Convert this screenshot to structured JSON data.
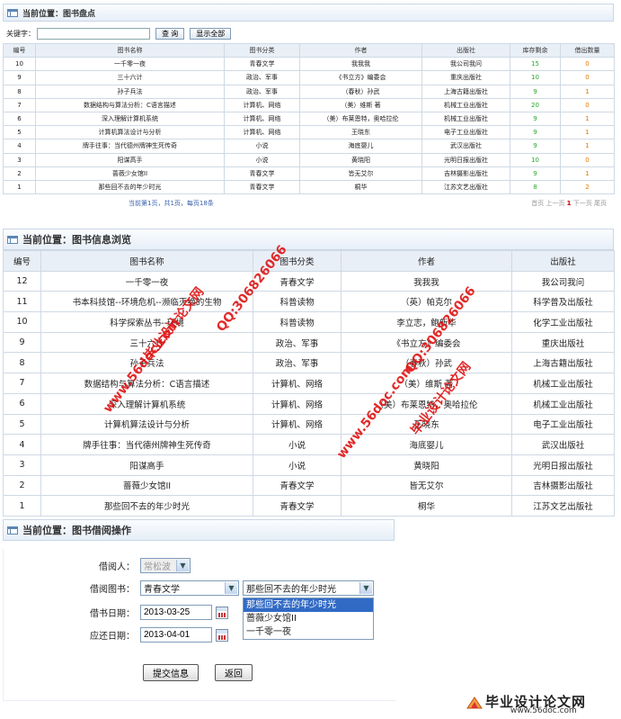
{
  "panel1": {
    "title": "当前位置：图书盘点",
    "search_label": "关键字：",
    "search_value": "",
    "search_button": "查 询",
    "show_all_button": "显示全部",
    "headers": [
      "编号",
      "图书名称",
      "图书分类",
      "作者",
      "出版社",
      "库存剩余",
      "借出数量"
    ],
    "rows": [
      [
        "10",
        "一千零一夜",
        "青春文学",
        "我我我",
        "我公司我问",
        "15",
        "0"
      ],
      [
        "9",
        "三十六计",
        "政治、军事",
        "《书立方》编委会",
        "重庆出版社",
        "10",
        "0"
      ],
      [
        "8",
        "孙子兵法",
        "政治、军事",
        "（春秋）孙武",
        "上海古籍出版社",
        "9",
        "1"
      ],
      [
        "7",
        "数据结构与算法分析：C语言描述",
        "计算机、网络",
        "（美）维斯 著",
        "机械工业出版社",
        "20",
        "0"
      ],
      [
        "6",
        "深入理解计算机系统",
        "计算机、网络",
        "（美）布莱恩特，奥哈拉伦",
        "机械工业出版社",
        "9",
        "1"
      ],
      [
        "5",
        "计算机算法设计与分析",
        "计算机、网络",
        "王晓东",
        "电子工业出版社",
        "9",
        "1"
      ],
      [
        "4",
        "牌手往事：当代德州牌神生死传奇",
        "小说",
        "海底婴儿",
        "武汉出版社",
        "9",
        "1"
      ],
      [
        "3",
        "阳谋高手",
        "小说",
        "黄晓阳",
        "光明日报出版社",
        "10",
        "0"
      ],
      [
        "2",
        "蔷薇少女馆II",
        "青春文学",
        "皆无艾尔",
        "吉林摄影出版社",
        "9",
        "1"
      ],
      [
        "1",
        "那些回不去的年少时光",
        "青春文学",
        "桐华",
        "江苏文艺出版社",
        "8",
        "2"
      ]
    ],
    "pager_left": "当前第1页，共1页，每页18条",
    "pager_right_prefix": "首页 上一页 ",
    "pager_right_current": "1",
    "pager_right_suffix": " 下一页 尾页"
  },
  "panel2": {
    "title": "当前位置：图书信息浏览",
    "headers": [
      "编号",
      "图书名称",
      "图书分类",
      "作者",
      "出版社"
    ],
    "rows": [
      [
        "12",
        "一千零一夜",
        "青春文学",
        "我我我",
        "我公司我问"
      ],
      [
        "11",
        "书本科技馆--环境危机--濒临灭绝的生物",
        "科普读物",
        "（英）帕克尔",
        "科学普及出版社"
      ],
      [
        "10",
        "科学探索丛书--环境",
        "科普读物",
        "李立志，鲍新华",
        "化学工业出版社"
      ],
      [
        "9",
        "三十六计",
        "政治、军事",
        "《书立方》编委会",
        "重庆出版社"
      ],
      [
        "8",
        "孙子兵法",
        "政治、军事",
        "（春秋）孙武",
        "上海古籍出版社"
      ],
      [
        "7",
        "数据结构与算法分析：C语言描述",
        "计算机、网络",
        "（美）维斯 著",
        "机械工业出版社"
      ],
      [
        "6",
        "深入理解计算机系统",
        "计算机、网络",
        "（美）布莱恩特，奥哈拉伦",
        "机械工业出版社"
      ],
      [
        "5",
        "计算机算法设计与分析",
        "计算机、网络",
        "王晓东",
        "电子工业出版社"
      ],
      [
        "4",
        "牌手往事：当代德州牌神生死传奇",
        "小说",
        "海底婴儿",
        "武汉出版社"
      ],
      [
        "3",
        "阳谋高手",
        "小说",
        "黄晓阳",
        "光明日报出版社"
      ],
      [
        "2",
        "蔷薇少女馆II",
        "青春文学",
        "皆无艾尔",
        "吉林摄影出版社"
      ],
      [
        "1",
        "那些回不去的年少时光",
        "青春文学",
        "桐华",
        "江苏文艺出版社"
      ]
    ]
  },
  "panel3": {
    "title": "当前位置：图书借阅操作",
    "borrower_label": "借阅人：",
    "borrower_value": "常松波",
    "book_label": "借阅图书：",
    "category_value": "青春文学",
    "book_value": "那些回不去的年少时光",
    "book_options": [
      "那些回不去的年少时光",
      "蔷薇少女馆II",
      "一千零一夜"
    ],
    "borrow_date_label": "借书日期：",
    "borrow_date_value": "2013-03-25",
    "due_date_label": "应还日期：",
    "due_date_value": "2013-04-01",
    "submit_button": "提交信息",
    "back_button": "返回"
  },
  "watermarks": [
    "毕业设计论文网",
    "www.56doc.com",
    "QQ:306826066",
    "毕业设计论文网",
    "www.56doc.com",
    "QQ:306826066"
  ],
  "logo": {
    "title": "毕业设计论文网",
    "url": "www.56doc.com"
  },
  "colors": {
    "stock": "#2aa52a",
    "lent": "#e07a00",
    "watermark": "#e01818",
    "header_bg": "#e9eff6"
  }
}
